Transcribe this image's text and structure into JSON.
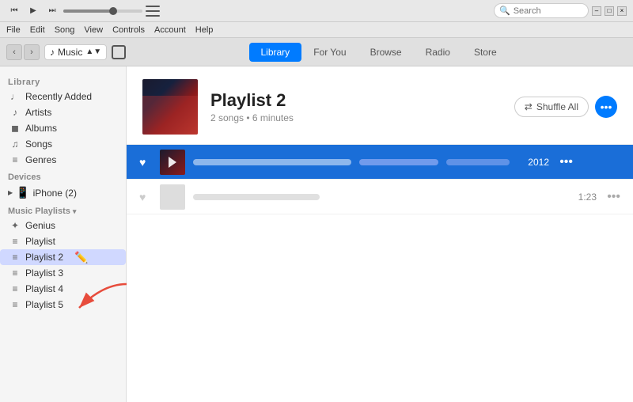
{
  "titlebar": {
    "playback": {
      "prev_label": "⏮",
      "play_label": "▶",
      "next_label": "⏭"
    },
    "apple_logo": "",
    "search_placeholder": "Search",
    "window_controls": {
      "minimize": "–",
      "restore": "□",
      "close": "×"
    }
  },
  "menubar": {
    "items": [
      "File",
      "Edit",
      "Song",
      "View",
      "Controls",
      "Account",
      "Help"
    ]
  },
  "navbar": {
    "nav_back": "‹",
    "nav_forward": "›",
    "source_label": "Music",
    "phone_icon": "📱",
    "tabs": [
      {
        "id": "library",
        "label": "Library",
        "active": true
      },
      {
        "id": "for-you",
        "label": "For You",
        "active": false
      },
      {
        "id": "browse",
        "label": "Browse",
        "active": false
      },
      {
        "id": "radio",
        "label": "Radio",
        "active": false
      },
      {
        "id": "store",
        "label": "Store",
        "active": false
      }
    ]
  },
  "sidebar": {
    "library_section": "Library",
    "library_items": [
      {
        "id": "recently-added",
        "label": "Recently Added",
        "icon": "♩"
      },
      {
        "id": "artists",
        "label": "Artists",
        "icon": "♪"
      },
      {
        "id": "albums",
        "label": "Albums",
        "icon": "◼"
      },
      {
        "id": "songs",
        "label": "Songs",
        "icon": "♫"
      },
      {
        "id": "genres",
        "label": "Genres",
        "icon": "≡"
      }
    ],
    "devices_section": "Devices",
    "device_item": "iPhone (2)",
    "playlists_section": "Music Playlists",
    "playlist_items": [
      {
        "id": "genius",
        "label": "Genius",
        "icon": "✦"
      },
      {
        "id": "playlist",
        "label": "Playlist",
        "icon": "≡"
      },
      {
        "id": "playlist-2",
        "label": "Playlist 2",
        "icon": "≡",
        "active": true
      },
      {
        "id": "playlist-3",
        "label": "Playlist 3",
        "icon": "≡"
      },
      {
        "id": "playlist-4",
        "label": "Playlist 4",
        "icon": "≡"
      },
      {
        "id": "playlist-5",
        "label": "Playlist 5",
        "icon": "≡"
      }
    ]
  },
  "content": {
    "playlist_title": "Playlist 2",
    "playlist_meta": "2 songs • 6 minutes",
    "shuffle_label": "Shuffle All",
    "shuffle_icon": "⇄",
    "more_icon": "•••",
    "tracks": [
      {
        "id": "track-1",
        "playing": true,
        "heart": "♥",
        "year": "2012",
        "dots": "•••"
      },
      {
        "id": "track-2",
        "playing": false,
        "duration": "1:23",
        "dots": "•••"
      }
    ]
  },
  "arrow": {
    "label": "→"
  }
}
